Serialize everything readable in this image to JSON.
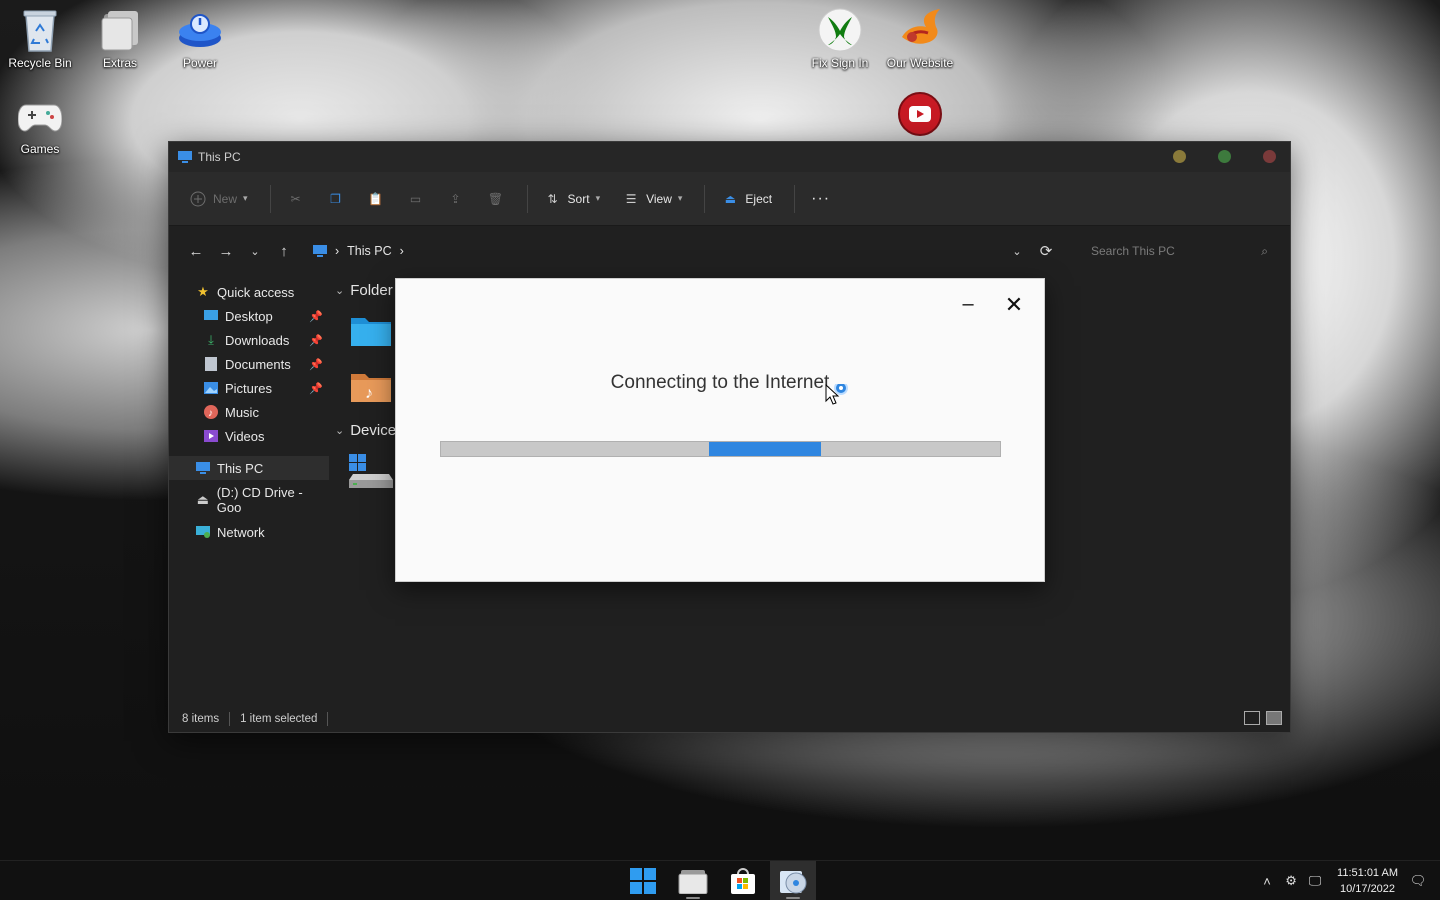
{
  "desktop": {
    "icons": [
      {
        "name": "recycle-bin",
        "label": "Recycle Bin"
      },
      {
        "name": "extras",
        "label": "Extras"
      },
      {
        "name": "power",
        "label": "Power"
      },
      {
        "name": "games",
        "label": "Games"
      },
      {
        "name": "fix-sign-in",
        "label": "Fix Sign In"
      },
      {
        "name": "our-website",
        "label": "Our Website"
      }
    ]
  },
  "explorer": {
    "title": "This PC",
    "toolbar": {
      "new_label": "New",
      "sort_label": "Sort",
      "view_label": "View",
      "eject_label": "Eject",
      "more_label": "···"
    },
    "address": {
      "crumb": "This PC",
      "search_placeholder": "Search This PC"
    },
    "nav": {
      "quick_access": "Quick access",
      "items": [
        {
          "label": "Desktop",
          "pinned": true
        },
        {
          "label": "Downloads",
          "pinned": true
        },
        {
          "label": "Documents",
          "pinned": true
        },
        {
          "label": "Pictures",
          "pinned": true
        },
        {
          "label": "Music",
          "pinned": false
        },
        {
          "label": "Videos",
          "pinned": false
        }
      ],
      "this_pc": "This PC",
      "cd_drive": "(D:) CD Drive - Goo",
      "network": "Network"
    },
    "content": {
      "folders_header": "Folder",
      "devices_header": "Device"
    },
    "status": {
      "items": "8 items",
      "selected": "1 item selected"
    }
  },
  "dialog": {
    "message": "Connecting to the Internet",
    "minimize_label": "–",
    "close_label": "✕",
    "progress_start": 0.48,
    "progress_end": 0.68
  },
  "taskbar": {
    "time": "11:51:01 AM",
    "date": "10/17/2022"
  },
  "colors": {
    "accent": "#2f86e0",
    "window_bg": "#202020",
    "dialog_bg": "#fafafa"
  }
}
